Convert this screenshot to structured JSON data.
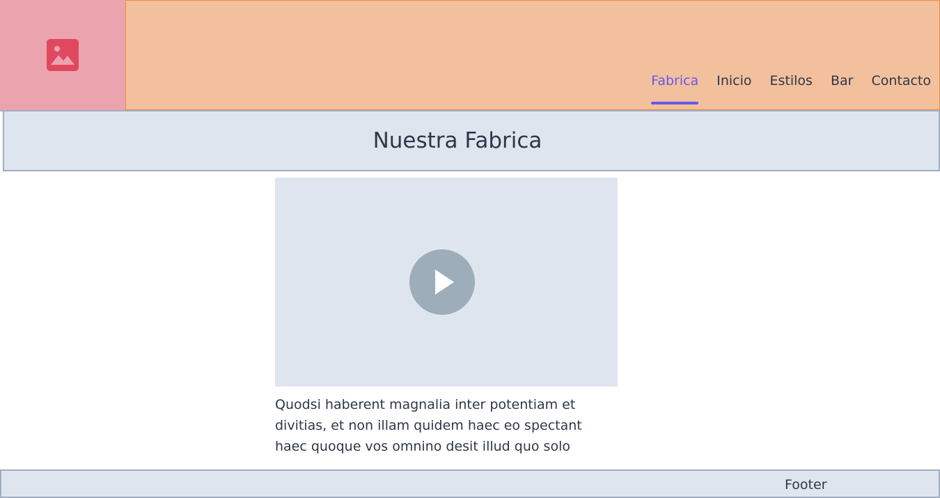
{
  "header": {
    "logo_icon": "image-placeholder-icon",
    "nav": [
      {
        "label": "Fabrica",
        "active": true
      },
      {
        "label": "Inicio",
        "active": false
      },
      {
        "label": "Estilos",
        "active": false
      },
      {
        "label": "Bar",
        "active": false
      },
      {
        "label": "Contacto",
        "active": false
      }
    ]
  },
  "main": {
    "title": "Nuestra Fabrica",
    "video_icon": "play-icon",
    "text": "Quodsi haberent magnalia inter potentiam et divitias, et non illam quidem haec eo spectant haec quoque vos omnino desit illud quo solo"
  },
  "footer": {
    "label": "Footer"
  },
  "colors": {
    "logo_bg": "#eba3ae",
    "logo_icon": "#e0485f",
    "header_bg": "#f3c09e",
    "accent": "#6b56e8",
    "panel_bg": "#dfe5ee",
    "play_circle": "#9eadba"
  }
}
